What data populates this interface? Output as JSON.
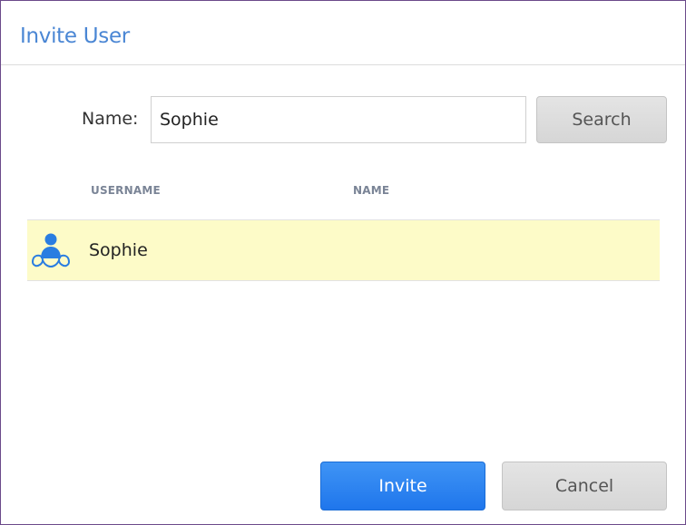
{
  "dialog": {
    "title": "Invite User"
  },
  "search": {
    "label": "Name:",
    "value": "Sophie",
    "button_label": "Search"
  },
  "table": {
    "columns": [
      "USERNAME",
      "NAME"
    ],
    "rows": [
      {
        "username": "Sophie",
        "name": "",
        "icon": "user-group-icon",
        "selected": true
      }
    ]
  },
  "footer": {
    "invite_label": "Invite",
    "cancel_label": "Cancel"
  },
  "colors": {
    "title": "#4a86d4",
    "selected_row": "#fdfbc8",
    "primary_button": "#2a82f0",
    "dialog_border": "#6b4a8a"
  }
}
